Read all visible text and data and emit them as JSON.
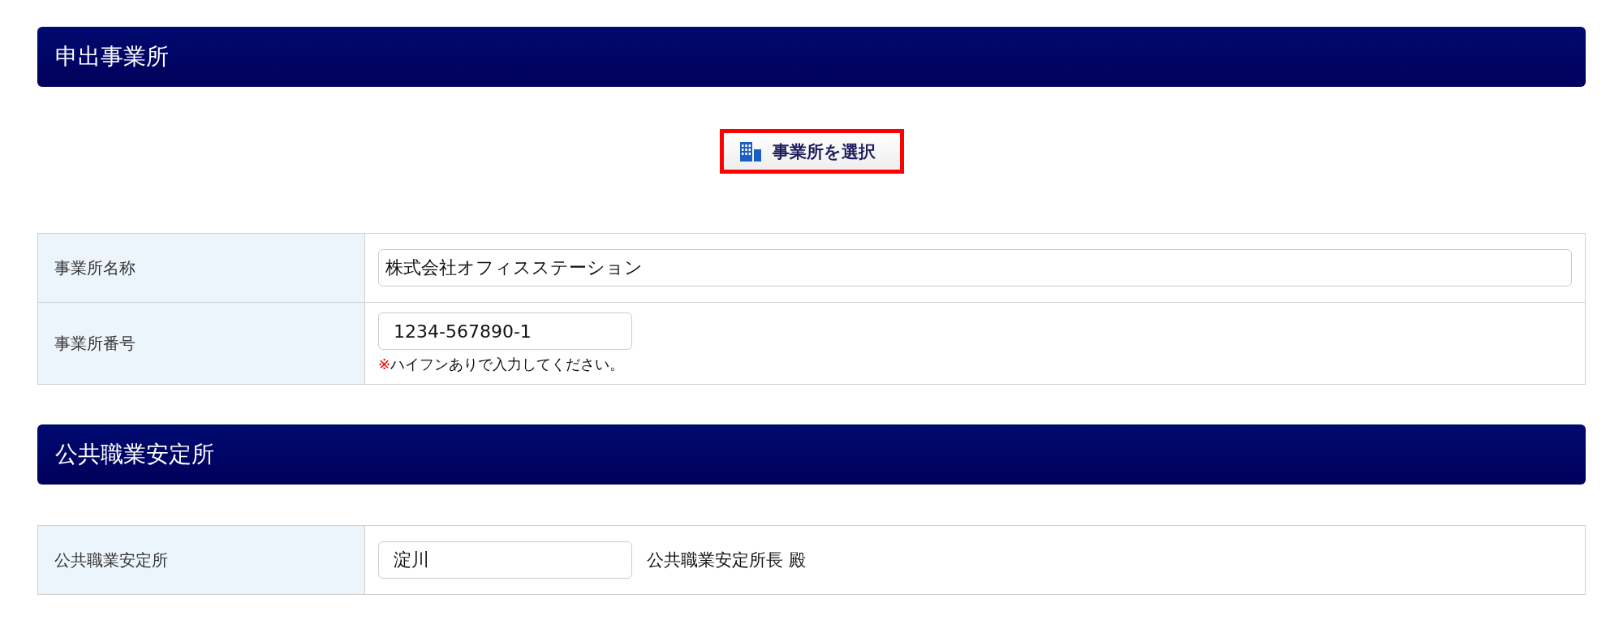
{
  "sections": [
    {
      "title": "申出事業所",
      "select_button": {
        "label": "事業所を選択",
        "highlighted": true
      },
      "rows": [
        {
          "label": "事業所名称",
          "kind": "wide",
          "value": "株式会社オフィスステーション"
        },
        {
          "label": "事業所番号",
          "kind": "short",
          "value": "1234-567890-1",
          "note_mark": "※",
          "note": "ハイフンありで入力してください。"
        }
      ]
    },
    {
      "title": "公共職業安定所",
      "rows": [
        {
          "label": "公共職業安定所",
          "kind": "short",
          "value": "淀川",
          "suffix": "公共職業安定所長 殿"
        }
      ]
    }
  ]
}
